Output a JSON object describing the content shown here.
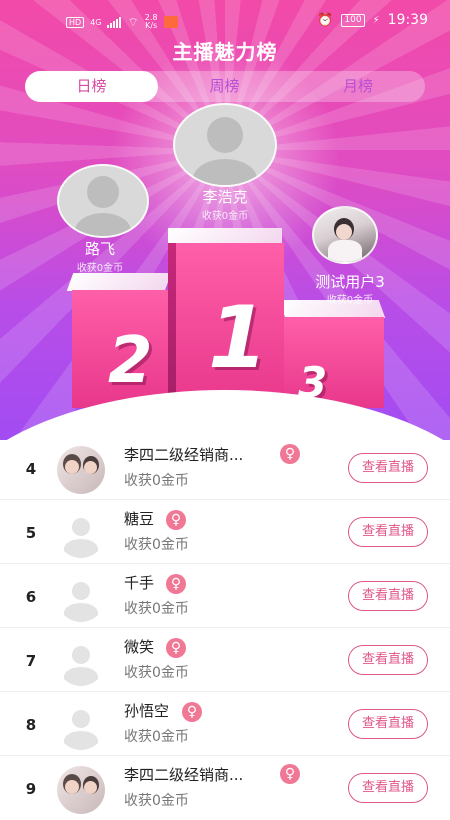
{
  "status_bar": {
    "hd": "HD",
    "network": "4G",
    "speed_value": "2.8",
    "speed_unit": "K/s",
    "battery": "100",
    "time": "19:39"
  },
  "page": {
    "title": "主播魅力榜"
  },
  "tabs": [
    {
      "label": "日榜",
      "active": true
    },
    {
      "label": "周榜",
      "active": false
    },
    {
      "label": "月榜",
      "active": false
    }
  ],
  "podium": {
    "first": {
      "rank": "1",
      "name": "李浩克",
      "coins": "收获0金币"
    },
    "second": {
      "rank": "2",
      "name": "路飞",
      "coins": "收获0金币"
    },
    "third": {
      "rank": "3",
      "name": "测试用户3",
      "coins": "收获0金币"
    }
  },
  "list": [
    {
      "rank": "4",
      "name": "李四二级经销商...",
      "coins": "收获0金币",
      "gender": "♀",
      "button": "查看直播",
      "avatar": "photo"
    },
    {
      "rank": "5",
      "name": "糖豆",
      "coins": "收获0金币",
      "gender": "♀",
      "button": "查看直播",
      "avatar": "default"
    },
    {
      "rank": "6",
      "name": "千手",
      "coins": "收获0金币",
      "gender": "♀",
      "button": "查看直播",
      "avatar": "default"
    },
    {
      "rank": "7",
      "name": "微笑",
      "coins": "收获0金币",
      "gender": "♀",
      "button": "查看直播",
      "avatar": "default"
    },
    {
      "rank": "8",
      "name": "孙悟空",
      "coins": "收获0金币",
      "gender": "♀",
      "button": "查看直播",
      "avatar": "default"
    },
    {
      "rank": "9",
      "name": "李四二级经销商...",
      "coins": "收获0金币",
      "gender": "♀",
      "button": "查看直播",
      "avatar": "photo"
    }
  ],
  "colors": {
    "gradient_top": "#f24aa8",
    "gradient_bottom": "#a24cf2",
    "accent": "#e0568a",
    "female_badge": "#f07895"
  }
}
